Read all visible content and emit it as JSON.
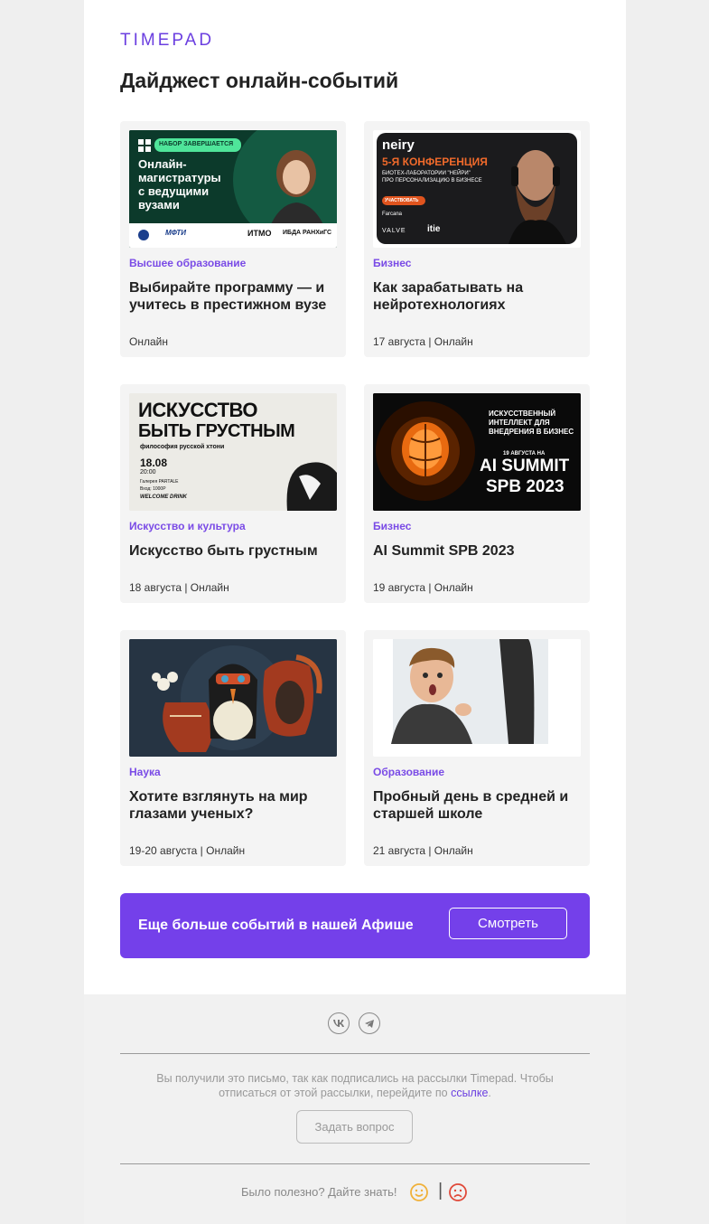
{
  "header": {
    "logo": "TIMEPAD",
    "title": "Дайджест онлайн-событий"
  },
  "events": [
    {
      "category": "Высшее образование",
      "title": "Выбирайте программу — и учитесь в престижном вузе",
      "meta": "Онлайн",
      "image": {
        "badge": "НАБОР ЗАВЕРШАЕТСЯ",
        "headline": "Онлайн-\nмагистратуры\nс ведущими\nвузами",
        "logos": [
          "МФТИ",
          "ИТМО",
          "ИБДА РАНХиГС"
        ]
      }
    },
    {
      "category": "Бизнес",
      "title": "Как зарабатывать на нейротехнологиях",
      "meta": "17 августа  | Онлайн",
      "image": {
        "brand": "neiry",
        "headline": "5-Я КОНФЕРЕНЦИЯ",
        "sub": "БИОТЕХ-ЛАБОРАТОРИИ \"НЕЙРИ\"\nПРО ПЕРСОНАЛИЗАЦИЮ В БИЗНЕСЕ",
        "button": "УЧАСТВОВАТЬ",
        "logos": [
          "Farcana",
          "VALVE",
          "itie"
        ]
      }
    },
    {
      "category": "Искусство и культура",
      "title": "Искусство быть грустным",
      "meta": "18 августа | Онлайн",
      "image": {
        "headline1": "ИСКУССТВО",
        "headline2": "БЫТЬ ГРУСТНЫМ",
        "sub": "философия русской хтони",
        "date": "18.08",
        "time": "20:00",
        "place": "Галерея PARTALE",
        "price": "Вход: 1000Р",
        "extra": "WELCOME DRINK"
      }
    },
    {
      "category": "Бизнес",
      "title": "AI Summit SPB 2023",
      "meta": "19 августа | Онлайн",
      "image": {
        "line1": "ИСКУССТВЕННЫЙ",
        "line2": "ИНТЕЛЛЕКТ ДЛЯ",
        "line3": "ВНЕДРЕНИЯ В БИЗНЕС",
        "date": "19 АВГУСТА НА",
        "big1": "AI SUMMIT",
        "big2": "SPB 2023"
      }
    },
    {
      "category": "Наука",
      "title": "Хотите взглянуть на мир глазами ученых?",
      "meta": "19-20 августа | Онлайн",
      "image": {}
    },
    {
      "category": "Образование",
      "title": "Пробный день в средней и старшей школе",
      "meta": "21 августа | Онлайн",
      "image": {}
    }
  ],
  "banner": {
    "text": "Еще больше событий в нашей Афише",
    "button": "Смотреть"
  },
  "footer": {
    "socials": [
      "vk-icon",
      "telegram-icon"
    ],
    "note_prefix": "Вы получили это письмо, так как подписались на рассылки Timepad. Чтобы отписаться от этой рассылки, перейдите по ",
    "note_link": "ссылке",
    "note_suffix": ".",
    "ask_button": "Задать вопрос",
    "feedback_text": "Было полезно? Дайте знать!",
    "separator": "|"
  },
  "colors": {
    "accent": "#7440ea",
    "background": "#efefef"
  }
}
